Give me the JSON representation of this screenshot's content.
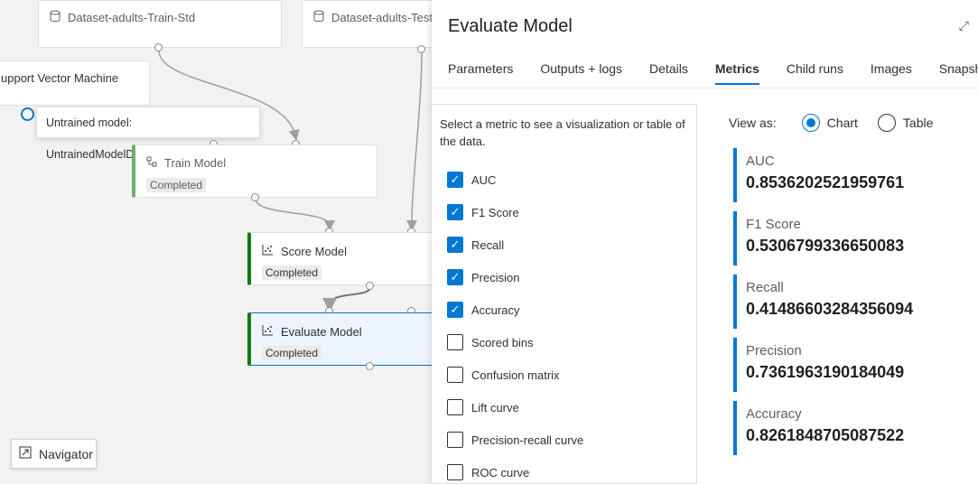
{
  "canvas": {
    "nodes": {
      "train_std": "Dataset-adults-Train-Std",
      "test": "Dataset-adults-Test",
      "svm": "upport Vector Machine",
      "train_model": {
        "title": "Train Model",
        "status": "Completed"
      },
      "score_model": {
        "title": "Score Model",
        "status": "Completed"
      },
      "evaluate_model": {
        "title": "Evaluate Model",
        "status": "Completed"
      }
    },
    "tooltip": "Untrained model: UntrainedModelDirectory",
    "navigator": "Navigator"
  },
  "panel": {
    "title": "Evaluate Model",
    "tabs": [
      "Parameters",
      "Outputs + logs",
      "Details",
      "Metrics",
      "Child runs",
      "Images",
      "Snapshot"
    ],
    "active_tab": "Metrics",
    "hint": "Select a metric to see a visualization or table of the data.",
    "metric_options": [
      {
        "label": "AUC",
        "checked": true
      },
      {
        "label": "F1 Score",
        "checked": true
      },
      {
        "label": "Recall",
        "checked": true
      },
      {
        "label": "Precision",
        "checked": true
      },
      {
        "label": "Accuracy",
        "checked": true
      },
      {
        "label": "Scored bins",
        "checked": false
      },
      {
        "label": "Confusion matrix",
        "checked": false
      },
      {
        "label": "Lift curve",
        "checked": false
      },
      {
        "label": "Precision-recall curve",
        "checked": false
      },
      {
        "label": "ROC curve",
        "checked": false
      }
    ],
    "view_as": {
      "label": "View as:",
      "chart": "Chart",
      "table": "Table",
      "selected": "Chart"
    },
    "metrics": [
      {
        "name": "AUC",
        "value": "0.8536202521959761"
      },
      {
        "name": "F1 Score",
        "value": "0.5306799336650083"
      },
      {
        "name": "Recall",
        "value": "0.41486603284356094"
      },
      {
        "name": "Precision",
        "value": "0.7361963190184049"
      },
      {
        "name": "Accuracy",
        "value": "0.8261848705087522"
      }
    ],
    "accent_color": "#0078d4"
  }
}
